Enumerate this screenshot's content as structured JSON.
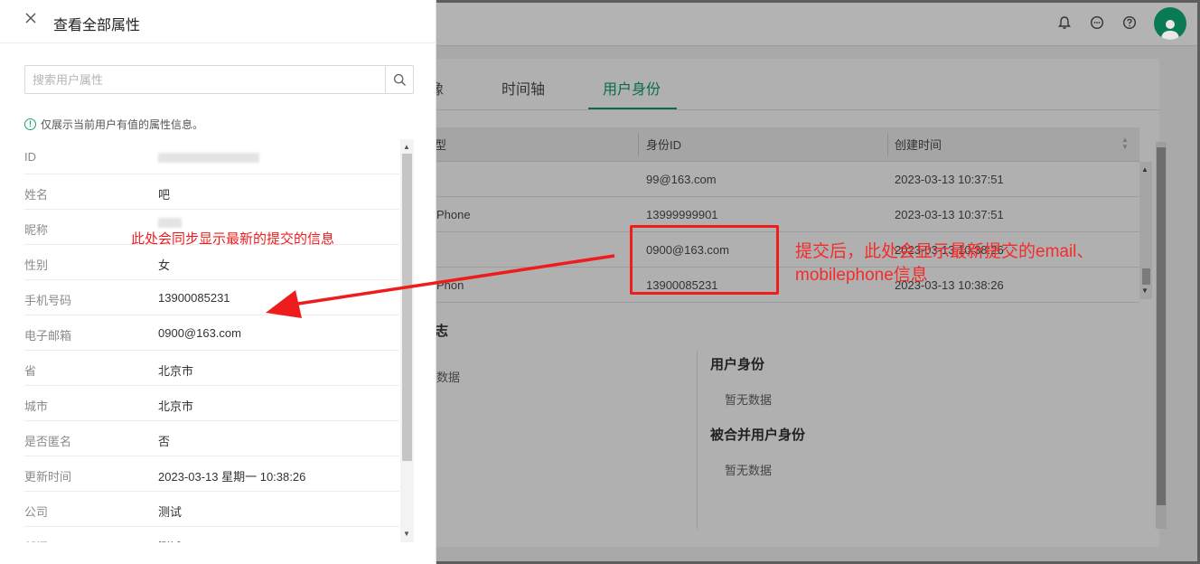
{
  "drawer": {
    "title": "查看全部属性",
    "search_placeholder": "搜索用户属性",
    "info_text": "仅展示当前用户有值的属性信息。",
    "attributes": [
      {
        "key": "ID",
        "value": ""
      },
      {
        "key": "姓名",
        "value": "吧"
      },
      {
        "key": "昵称",
        "value": ""
      },
      {
        "key": "性别",
        "value": "女"
      },
      {
        "key": "手机号码",
        "value": "13900085231"
      },
      {
        "key": "电子邮箱",
        "value": "0900@163.com"
      },
      {
        "key": "省",
        "value": "北京市"
      },
      {
        "key": "城市",
        "value": "北京市"
      },
      {
        "key": "是否匿名",
        "value": "否"
      },
      {
        "key": "更新时间",
        "value": "2023-03-13 星期一 10:38:26"
      },
      {
        "key": "公司",
        "value": "测试"
      },
      {
        "key": "部门",
        "value": "测试"
      }
    ]
  },
  "main": {
    "tabs": [
      {
        "label": "像"
      },
      {
        "label": "时间轴"
      },
      {
        "label": "用户身份"
      }
    ],
    "active_tab": "用户身份",
    "table": {
      "headers": [
        "型",
        "身份ID",
        "创建时间"
      ],
      "rows": [
        {
          "type": "",
          "id": "99@163.com",
          "created": "2023-03-13 10:37:51"
        },
        {
          "type": "Phone",
          "id": "13999999901",
          "created": "2023-03-13 10:37:51"
        },
        {
          "type": "",
          "id": "0900@163.com",
          "created": "2023-03-13 10:38:26"
        },
        {
          "type": "Phon",
          "id": "13900085231",
          "created": "2023-03-13 10:38:26"
        }
      ]
    },
    "log_title": "志",
    "log_nodata": "数据",
    "identity_title": "用户身份",
    "identity_nodata": "暂无数据",
    "merged_title": "被合并用户身份",
    "merged_nodata": "暂无数据"
  },
  "annotations": {
    "left_note": "此处会同步显示最新的提交的信息",
    "right_note": "提交后，此处会显示最新提交的email、mobilephone信息"
  },
  "colors": {
    "accent": "#0a6b4a",
    "annotation_red": "#ee1c1c",
    "info_green": "#1ea06c"
  }
}
